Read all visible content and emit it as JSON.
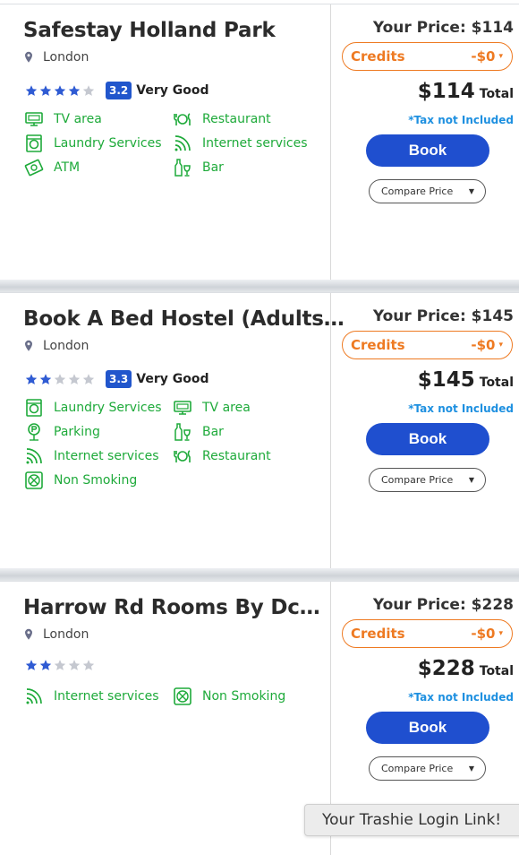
{
  "colors": {
    "green": "#1eaa3a",
    "blue": "#1f4fcf",
    "orange": "#ee7a22",
    "tax_blue": "#1e90e0",
    "star_filled": "#2f5bd3",
    "star_empty": "#c5c8d0"
  },
  "listings": [
    {
      "name": "Safestay Holland Park",
      "location": "London",
      "stars_filled": 4,
      "stars_total": 5,
      "rating_score": "3.2",
      "rating_text": "Very Good",
      "amenities": [
        {
          "label": "TV area",
          "icon": "tv-icon"
        },
        {
          "label": "Restaurant",
          "icon": "restaurant-icon"
        },
        {
          "label": "Laundry Services",
          "icon": "laundry-icon"
        },
        {
          "label": "Internet services",
          "icon": "wifi-icon"
        },
        {
          "label": "ATM",
          "icon": "atm-icon"
        },
        {
          "label": "Bar",
          "icon": "bar-icon"
        }
      ],
      "your_price": "Your Price: $114",
      "credits_label": "Credits",
      "credits_value": "-$0",
      "total_price": "$114",
      "total_label": "Total",
      "tax_note": "*Tax not Included",
      "book_label": "Book",
      "compare_label": "Compare Price"
    },
    {
      "name": "Book A Bed Hostel (Adults…",
      "location": "London",
      "stars_filled": 2,
      "stars_total": 5,
      "rating_score": "3.3",
      "rating_text": "Very Good",
      "amenities": [
        {
          "label": "Laundry Services",
          "icon": "laundry-icon"
        },
        {
          "label": "TV area",
          "icon": "tv-icon"
        },
        {
          "label": "Parking",
          "icon": "parking-icon"
        },
        {
          "label": "Bar",
          "icon": "bar-icon"
        },
        {
          "label": "Internet services",
          "icon": "wifi-icon"
        },
        {
          "label": "Restaurant",
          "icon": "restaurant-icon"
        },
        {
          "label": "Non Smoking",
          "icon": "no-smoking-icon"
        }
      ],
      "your_price": "Your Price: $145",
      "credits_label": "Credits",
      "credits_value": "-$0",
      "total_price": "$145",
      "total_label": "Total",
      "tax_note": "*Tax not Included",
      "book_label": "Book",
      "compare_label": "Compare Price"
    },
    {
      "name": "Harrow Rd Rooms By Dc…",
      "location": "London",
      "stars_filled": 2,
      "stars_total": 5,
      "rating_score": "",
      "rating_text": "",
      "amenities": [
        {
          "label": "Internet services",
          "icon": "wifi-icon"
        },
        {
          "label": "Non Smoking",
          "icon": "no-smoking-icon"
        }
      ],
      "your_price": "Your Price: $228",
      "credits_label": "Credits",
      "credits_value": "-$0",
      "total_price": "$228",
      "total_label": "Total",
      "tax_note": "*Tax not Included",
      "book_label": "Book",
      "compare_label": "Compare Price"
    }
  ],
  "toast": {
    "text": "Your Trashie Login Link!"
  }
}
